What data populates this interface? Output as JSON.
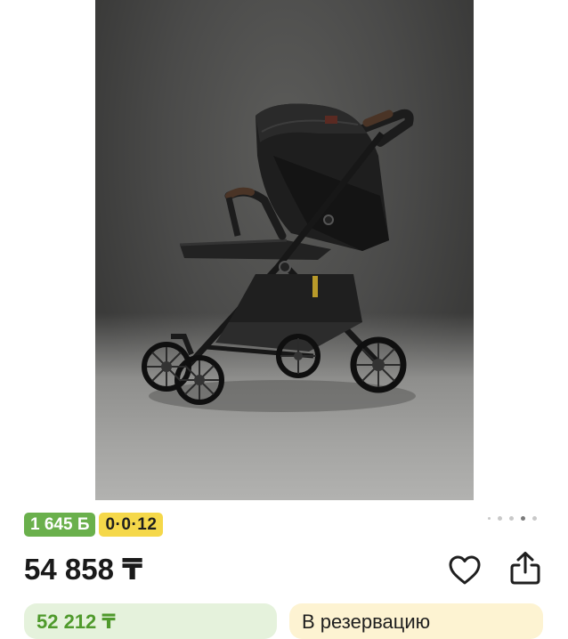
{
  "product": {
    "image_alt": "stroller-photo",
    "carousel": {
      "count": 5,
      "active_index": 3
    }
  },
  "badges": {
    "bonus": "1 645 Б",
    "installment": "0·0·12"
  },
  "price": "54 858 ₸",
  "actions": {
    "favorite_icon": "heart-icon",
    "share_icon": "share-icon"
  },
  "cards": {
    "green_price": "52 212 ₸",
    "reserve_label": "В резервацию"
  },
  "colors": {
    "bonus_green": "#6ab04c",
    "installment_yellow": "#f5d84a",
    "green_card_bg": "#e5f2dc",
    "yellow_card_bg": "#fdf3d2"
  }
}
